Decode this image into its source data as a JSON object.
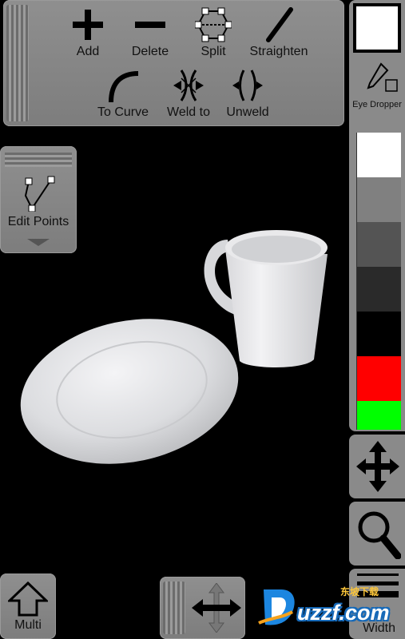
{
  "toolbar": {
    "add": "Add",
    "delete": "Delete",
    "split": "Split",
    "straighten": "Straighten",
    "to_curve": "To Curve",
    "weld_to": "Weld to",
    "unweld": "Unweld"
  },
  "edit_points": {
    "label": "Edit Points"
  },
  "right_panel": {
    "eye_dropper": "Eye Dropper",
    "width": "Width",
    "selected_color": "#ffffff",
    "palette": [
      "#ffffff",
      "#808080",
      "#545454",
      "#2a2a2a",
      "#000000",
      "#ff0000",
      "#00ff00"
    ]
  },
  "bottom": {
    "multi": "Multi"
  },
  "watermark": {
    "brand": "uzzf.com",
    "tagline": "东坡下载"
  },
  "icons": {
    "add": "plus-icon",
    "delete": "minus-icon",
    "split": "split-icon",
    "straighten": "straight-line-icon",
    "to_curve": "curve-icon",
    "weld": "weld-icon",
    "unweld": "unweld-icon",
    "edit_points": "node-path-icon",
    "move": "move-arrows-icon",
    "zoom": "magnifier-icon",
    "multi": "up-arrow-icon",
    "eye_dropper": "eyedropper-icon"
  }
}
